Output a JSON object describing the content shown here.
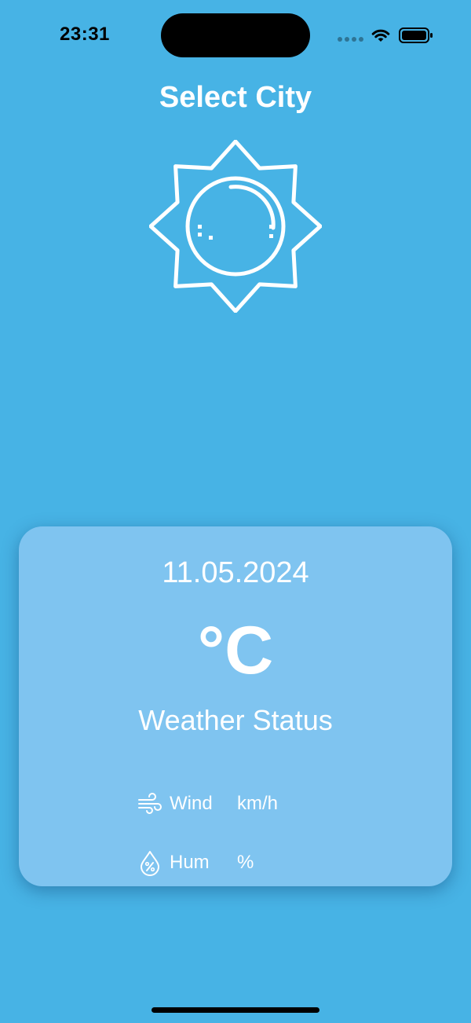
{
  "status_bar": {
    "time": "23:31"
  },
  "header": {
    "title": "Select City"
  },
  "main": {
    "icon": "sun-icon"
  },
  "card": {
    "date": "11.05.2024",
    "temperature": "°C",
    "status": "Weather Status",
    "details": [
      {
        "icon": "wind-icon",
        "label": "Wind",
        "unit": "km/h"
      },
      {
        "icon": "humidity-icon",
        "label": "Hum",
        "unit": "%"
      }
    ]
  },
  "colors": {
    "background": "#47b3e5",
    "card": "#7fc4f0",
    "text": "#ffffff"
  }
}
